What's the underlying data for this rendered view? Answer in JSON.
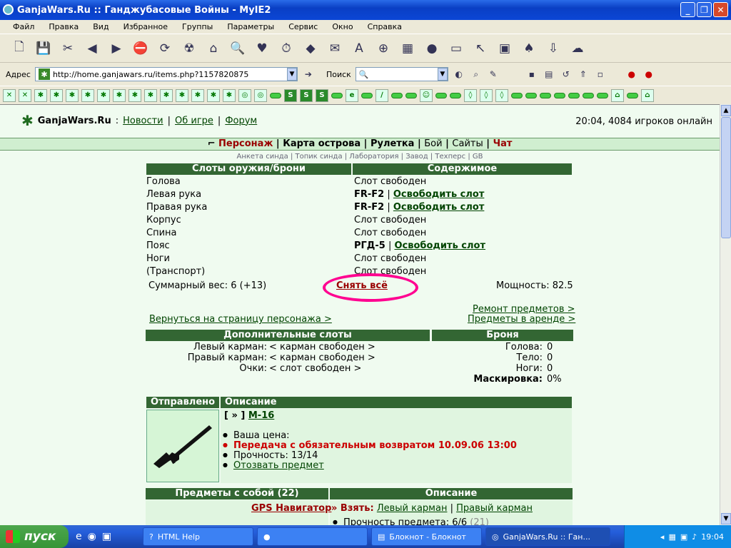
{
  "window": {
    "title": "GanjaWars.Ru :: Ганджубасовые Войны - MyIE2"
  },
  "menu": [
    "Файл",
    "Правка",
    "Вид",
    "Избранное",
    "Группы",
    "Параметры",
    "Сервис",
    "Окно",
    "Справка"
  ],
  "address": {
    "label": "Адрес",
    "url": "http://home.ganjawars.ru/items.php?1157820875",
    "search_label": "Поиск"
  },
  "site": {
    "brand": "GanjaWars.Ru",
    "sep": ":",
    "links": [
      "Новости",
      "Об игре",
      "Форум"
    ],
    "online": "20:04, 4084 игроков онлайн"
  },
  "nav": {
    "items": [
      "Персонаж",
      "Карта острова",
      "Рулетка",
      "Бой",
      "Сайты",
      "Чат"
    ],
    "sub": "Анкета синда | Топик синда | Лаборатория | Завод | Техперс | GB"
  },
  "slots": {
    "header_left": "Слоты оружия/брони",
    "header_right": "Содержимое",
    "rows": [
      {
        "slot": "Голова",
        "content": "Слот свободен",
        "item": "",
        "action": ""
      },
      {
        "slot": "Левая рука",
        "content": "",
        "item": "FR-F2",
        "action": "Освободить слот"
      },
      {
        "slot": "Правая рука",
        "content": "",
        "item": "FR-F2",
        "action": "Освободить слот"
      },
      {
        "slot": "Корпус",
        "content": "Слот свободен",
        "item": "",
        "action": ""
      },
      {
        "slot": "Спина",
        "content": "Слот свободен",
        "item": "",
        "action": ""
      },
      {
        "slot": "Пояс",
        "content": "",
        "item": "РГД-5",
        "action": "Освободить слот"
      },
      {
        "slot": "Ноги",
        "content": "Слот свободен",
        "item": "",
        "action": ""
      },
      {
        "slot": "(Транспорт)",
        "content": "Слот свободен",
        "item": "",
        "action": ""
      }
    ],
    "total_weight": "Суммарный вес: 6 (+13)",
    "remove_all": "Снять всё",
    "power": "Мощность: 82.5",
    "repair": "Ремонт предметов >",
    "rent": "Предметы в аренде >",
    "back": "Вернуться на страницу персонажа >"
  },
  "extra": {
    "header_left": "Дополнительные слоты",
    "header_right": "Броня",
    "rows": [
      {
        "label": "Левый карман:",
        "value": "< карман свободен >"
      },
      {
        "label": "Правый карман:",
        "value": "< карман свободен >"
      },
      {
        "label": "Очки:",
        "value": "< слот свободен >"
      }
    ],
    "armor": [
      {
        "label": "Голова:",
        "value": "0"
      },
      {
        "label": "Тело:",
        "value": "0"
      },
      {
        "label": "Ноги:",
        "value": "0"
      },
      {
        "label": "Маскировка:",
        "value": "0%"
      }
    ]
  },
  "sent": {
    "header_left": "Отправлено",
    "header_right": "Описание",
    "prefix": "[ » ]",
    "item_name": "M-16",
    "price": "Ваша цена:",
    "transfer": "Передача с обязательным возвратом 10.09.06 13:00",
    "durability": "Прочность: 13/14",
    "recall": "Отозвать предмет"
  },
  "carry": {
    "header_left": "Предметы с собой (22)",
    "header_right": "Описание",
    "item": "GPS Навигатор",
    "take_label": "» Взять:",
    "left_pocket": "Левый карман",
    "sep": "|",
    "right_pocket": "Правый карман",
    "durability": "Прочность предмета: 6/6",
    "durability_extra": "(21)"
  },
  "taskbar": {
    "start": "пуск",
    "tasks": [
      "HTML Help",
      "",
      "Блокнот - Блокнот",
      "GanjaWars.Ru :: Ган..."
    ],
    "lang": "RU",
    "clock": "19:04"
  }
}
